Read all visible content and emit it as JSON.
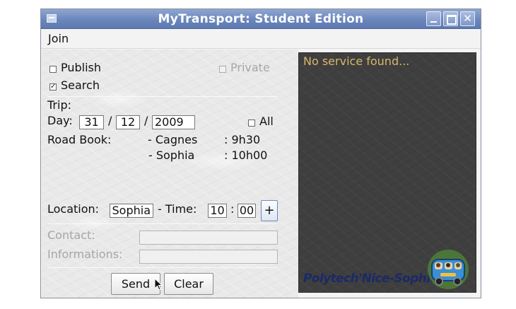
{
  "window": {
    "title": "MyTransport: Student Edition"
  },
  "menu": {
    "join": "Join"
  },
  "options": {
    "publish_label": "Publish",
    "publish_checked": false,
    "private_label": "Private",
    "private_checked": false,
    "search_label": "Search",
    "search_checked": true,
    "checked_glyph": "☑",
    "unchecked_glyph": "☐"
  },
  "trip": {
    "heading": "Trip:",
    "day_label": "Day:",
    "day": "31",
    "month": "12",
    "year": "2009",
    "slash": "/",
    "all_label": "All",
    "all_checked": false
  },
  "roadbook": {
    "label": "Road Book:",
    "stops": [
      {
        "place": "- Cagnes",
        "time": ": 9h30"
      },
      {
        "place": "- Sophia",
        "time": ": 10h00"
      }
    ]
  },
  "location": {
    "label": "Location:",
    "value": "Sophia",
    "time_label": "- Time:",
    "hour": "10",
    "colon": ":",
    "minute": "00",
    "add_label": "+"
  },
  "contact": {
    "label": "Contact:",
    "value": ""
  },
  "informations": {
    "label": "Informations:",
    "value": ""
  },
  "actions": {
    "send_label": "Send",
    "clear_label": "Clear"
  },
  "results": {
    "message": "No service found...",
    "brand": "Polytech'Nice-Sophia"
  },
  "colors": {
    "titlebar": "#6a86bd",
    "results_bg": "#3f3f3f",
    "results_text": "#d9b769",
    "brand_text": "#1b2a66"
  }
}
